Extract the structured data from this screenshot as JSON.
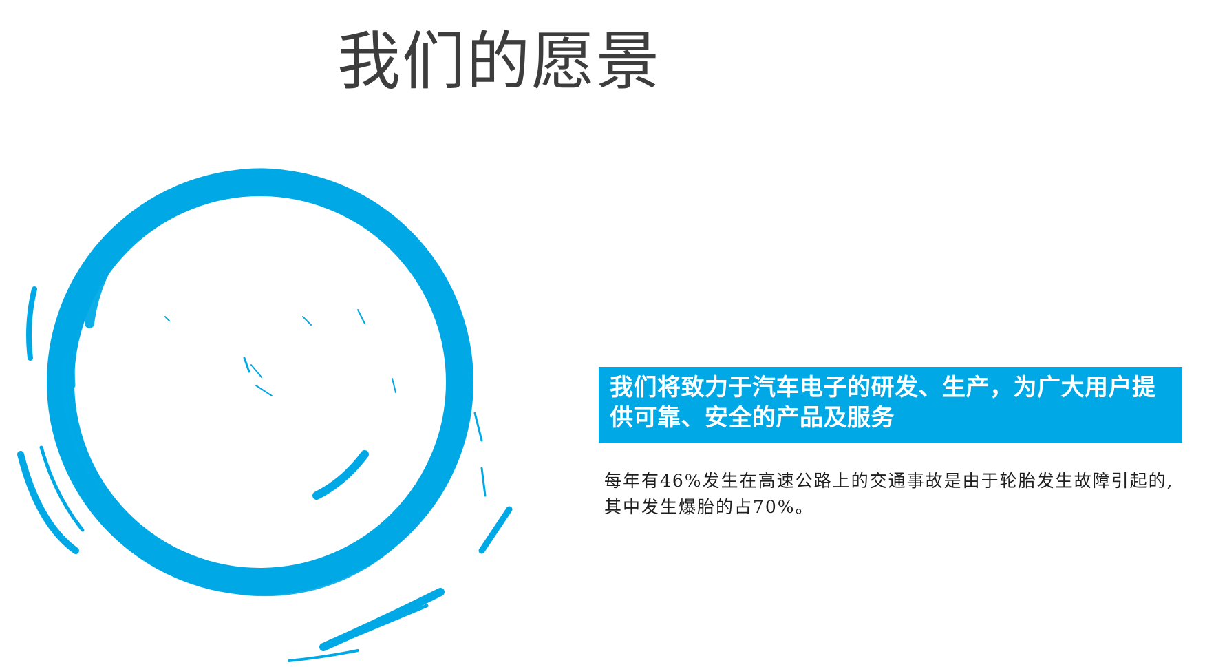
{
  "slide": {
    "title": "我们的愿景",
    "mission": "我们将致力于汽车电子的研发、生产，为广大用户提供可靠、安全的产品及服务",
    "statistic": "每年有46%发生在高速公路上的交通事故是由于轮胎发生故障引起的,其中发生爆胎的占70%。"
  },
  "colors": {
    "accent": "#00a9e6",
    "title": "#3d3d3d",
    "body_text": "#1e1e1e",
    "background": "#ffffff"
  },
  "graphics": {
    "decoration": "ink-brush-circle"
  }
}
